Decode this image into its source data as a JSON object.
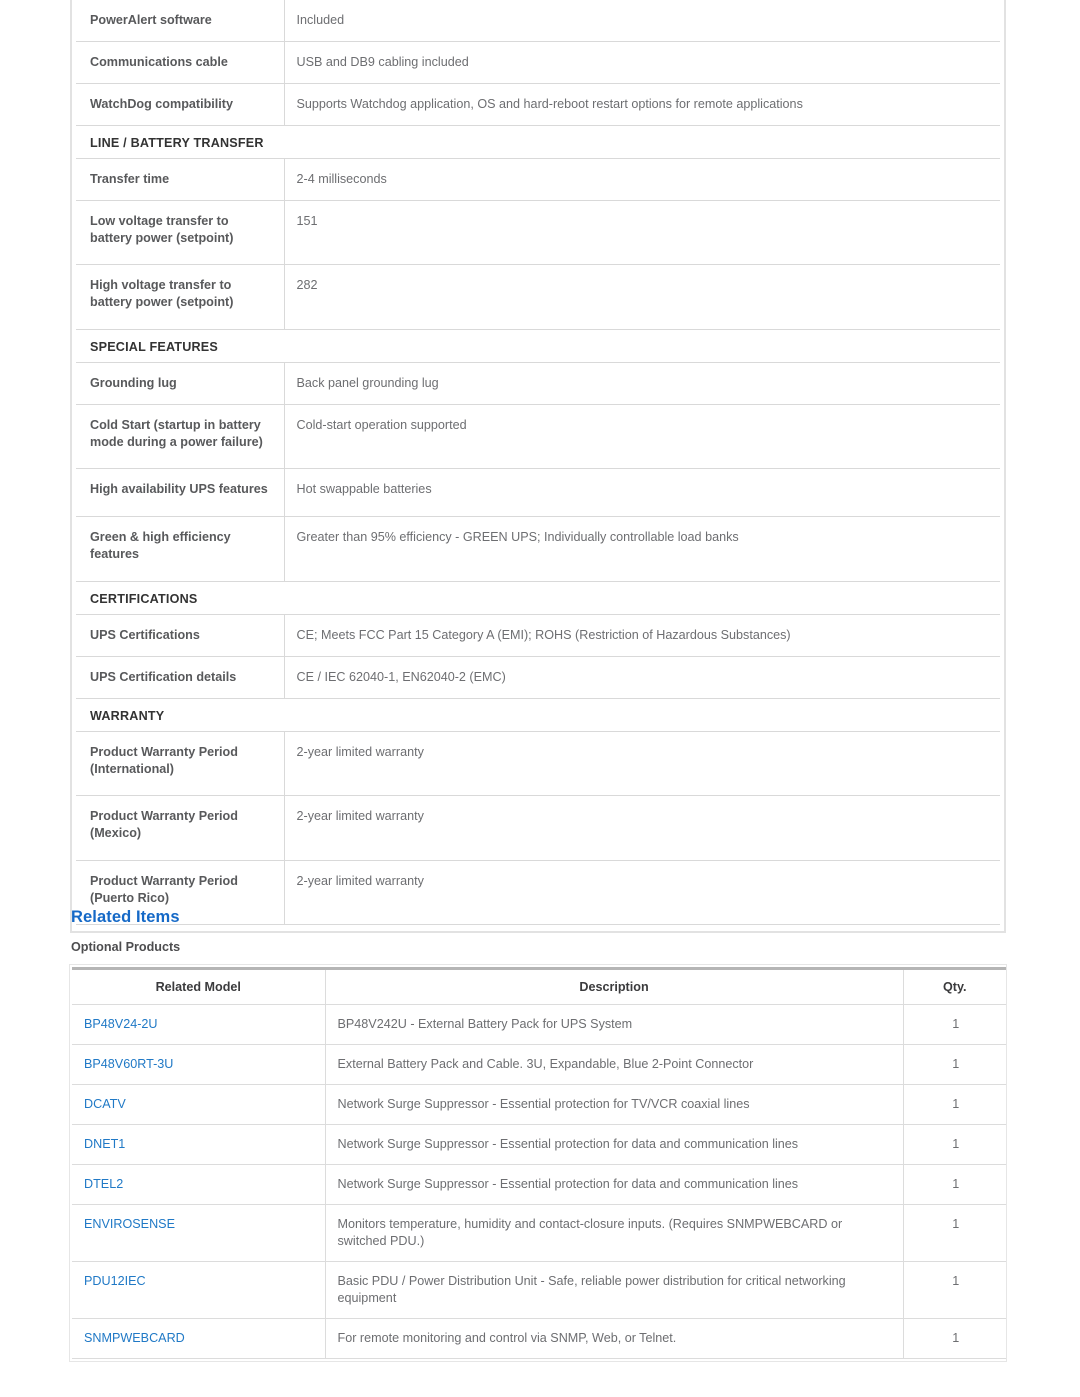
{
  "spec_table": {
    "rows": [
      {
        "type": "row",
        "label": "PowerAlert software",
        "value": "Included"
      },
      {
        "type": "row",
        "label": "Communications cable",
        "value": "USB and DB9 cabling included"
      },
      {
        "type": "row",
        "label": "WatchDog compatibility",
        "value": "Supports Watchdog application, OS and hard-reboot restart options for remote applications"
      },
      {
        "type": "section",
        "label": "LINE / BATTERY TRANSFER"
      },
      {
        "type": "row",
        "label": "Transfer time",
        "value": "2-4 milliseconds"
      },
      {
        "type": "row",
        "label": "Low voltage transfer to battery power (setpoint)",
        "value": "151"
      },
      {
        "type": "row",
        "label": "High voltage transfer to battery power (setpoint)",
        "value": "282"
      },
      {
        "type": "section",
        "label": "SPECIAL FEATURES"
      },
      {
        "type": "row",
        "label": "Grounding lug",
        "value": "Back panel grounding lug"
      },
      {
        "type": "row",
        "label": "Cold Start (startup in battery mode during a power failure)",
        "value": "Cold-start operation supported"
      },
      {
        "type": "row",
        "label": "High availability UPS features",
        "value": "Hot swappable batteries"
      },
      {
        "type": "row",
        "label": "Green & high efficiency features",
        "value": "Greater than 95% efficiency - GREEN UPS; Individually controllable load banks"
      },
      {
        "type": "section",
        "label": "CERTIFICATIONS"
      },
      {
        "type": "row",
        "label": "UPS Certifications",
        "value": "CE; Meets FCC Part 15 Category A (EMI); ROHS (Restriction of Hazardous Substances)"
      },
      {
        "type": "row",
        "label": "UPS Certification details",
        "value": "CE / IEC 62040-1, EN62040-2 (EMC)"
      },
      {
        "type": "section",
        "label": "WARRANTY"
      },
      {
        "type": "row",
        "label": "Product Warranty Period (International)",
        "value": "2-year limited warranty"
      },
      {
        "type": "row",
        "label": "Product Warranty Period (Mexico)",
        "value": "2-year limited warranty"
      },
      {
        "type": "row",
        "label": "Product Warranty Period (Puerto Rico)",
        "value": "2-year limited warranty"
      }
    ]
  },
  "related_items": {
    "heading": "Related Items",
    "subheading": "Optional Products",
    "columns": {
      "model": "Related Model",
      "description": "Description",
      "qty": "Qty."
    },
    "rows": [
      {
        "model": "BP48V24-2U",
        "description": "BP48V242U - External Battery Pack for UPS System",
        "qty": "1"
      },
      {
        "model": "BP48V60RT-3U",
        "description": "External Battery Pack and Cable. 3U, Expandable, Blue 2-Point Connector",
        "qty": "1"
      },
      {
        "model": "DCATV",
        "description": "Network Surge Suppressor - Essential protection for TV/VCR coaxial lines",
        "qty": "1"
      },
      {
        "model": "DNET1",
        "description": "Network Surge Suppressor - Essential protection for data and communication lines",
        "qty": "1"
      },
      {
        "model": "DTEL2",
        "description": "Network Surge Suppressor - Essential protection for data and communication lines",
        "qty": "1"
      },
      {
        "model": "ENVIROSENSE",
        "description": "Monitors temperature, humidity and contact-closure inputs. (Requires SNMPWEBCARD or switched PDU.)",
        "qty": "1"
      },
      {
        "model": "PDU12IEC",
        "description": "Basic PDU / Power Distribution Unit - Safe, reliable power distribution for critical networking equipment",
        "qty": "1"
      },
      {
        "model": "SNMPWEBCARD",
        "description": "For remote monitoring and control via SNMP, Web, or Telnet.",
        "qty": "1"
      }
    ]
  },
  "colors": {
    "link": "#2079c6",
    "heading": "#1569c7",
    "label_text": "#58595b",
    "value_text": "#6d6e71",
    "border": "#d9d9d9"
  }
}
